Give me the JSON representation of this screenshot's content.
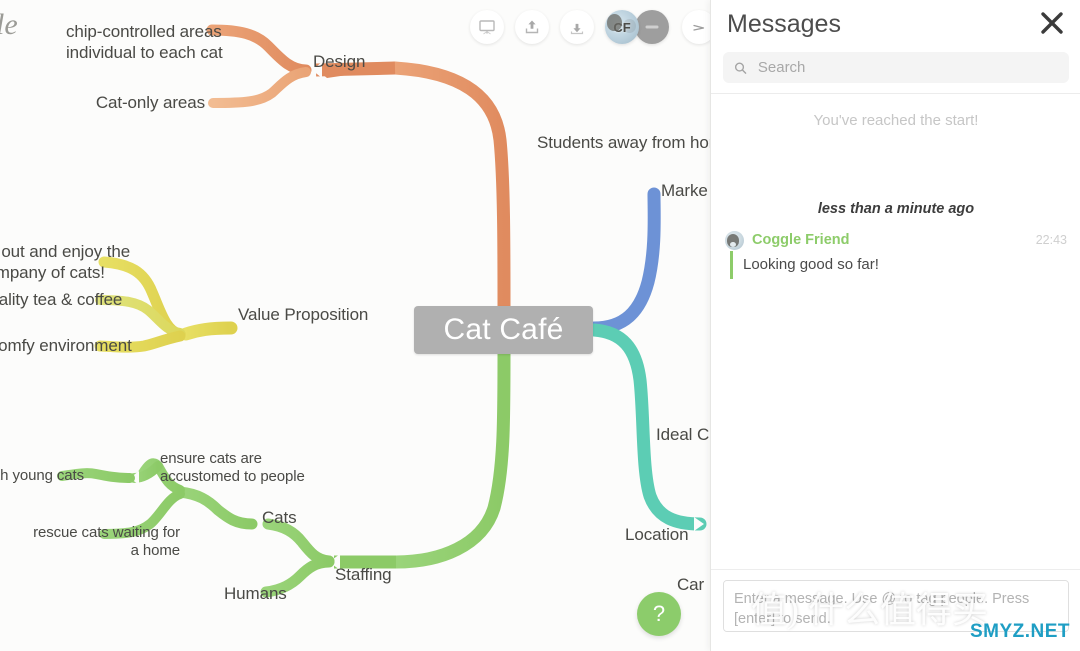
{
  "app": {
    "logo_fragment": "le"
  },
  "toolbar": {
    "items": [
      {
        "name": "present-icon",
        "label": "Present"
      },
      {
        "name": "upload-icon",
        "label": "Upload"
      },
      {
        "name": "download-icon",
        "label": "Download"
      },
      {
        "name": "share-icon",
        "label": "Share"
      }
    ],
    "avatars": [
      {
        "initials": "CF",
        "name": "Coggle Friend"
      },
      {
        "initials": "",
        "name": "collaborator"
      }
    ]
  },
  "mindmap": {
    "central_node": "Cat Café",
    "branches": [
      {
        "name": "design",
        "color": "#e79068",
        "label": "Design",
        "children": [
          {
            "label": "chip-controlled areas\nindividual to each cat",
            "color": "#e79068"
          },
          {
            "label": "Cat-only areas",
            "color": "#eeab79"
          }
        ]
      },
      {
        "name": "value-proposition",
        "color": "#e3d45c",
        "label": "Value Proposition",
        "children": [
          {
            "label": "ng out and enjoy the\ncompany of cats!",
            "color": "#e0d64f"
          },
          {
            "label": "quality tea & coffee",
            "color": "#d9dd6e"
          },
          {
            "label": "Comfy environment",
            "color": "#e6d35c"
          }
        ]
      },
      {
        "name": "staffing",
        "color": "#8fcc6b",
        "label": "Staffing",
        "children": [
          {
            "label": "Cats",
            "color": "#8fcc6b"
          },
          {
            "label": "Humans",
            "color": "#8fcc6b"
          },
          {
            "label": "ith young cats",
            "color": "#8fcc6b"
          },
          {
            "label": "ensure cats are\naccustomed to people",
            "color": "#8fcc6b"
          },
          {
            "label": "rescue cats waiting for\na home",
            "color": "#8fcc6b"
          }
        ]
      },
      {
        "name": "market",
        "color": "#6d92d6",
        "label": "Marke",
        "children": [
          {
            "label": "Students away from home",
            "color": "#6d92d6"
          }
        ]
      },
      {
        "name": "location",
        "color": "#5ccdb4",
        "label": "Location",
        "children": [
          {
            "label": "Ideal C",
            "color": "#5ccdb4"
          },
          {
            "label": "Car",
            "color": "#5ccdb4"
          }
        ]
      }
    ]
  },
  "help": {
    "label": "?"
  },
  "messages_panel": {
    "title": "Messages",
    "close_icon": "close-icon",
    "search": {
      "placeholder": "Search",
      "value": "",
      "icon": "search-icon"
    },
    "reached_start": "You've reached the start!",
    "time_separator": "less than a minute ago",
    "messages": [
      {
        "author": "Coggle Friend",
        "time": "22:43",
        "text": "Looking good so far!",
        "accent": "#8dcc6a"
      }
    ],
    "composer": {
      "placeholder": "Enter a message. Use @ to tag people. Press [enter] to send.",
      "value": ""
    }
  },
  "watermark": {
    "cjk": "值) 什么值得买",
    "site": "SMYZ.NET"
  }
}
